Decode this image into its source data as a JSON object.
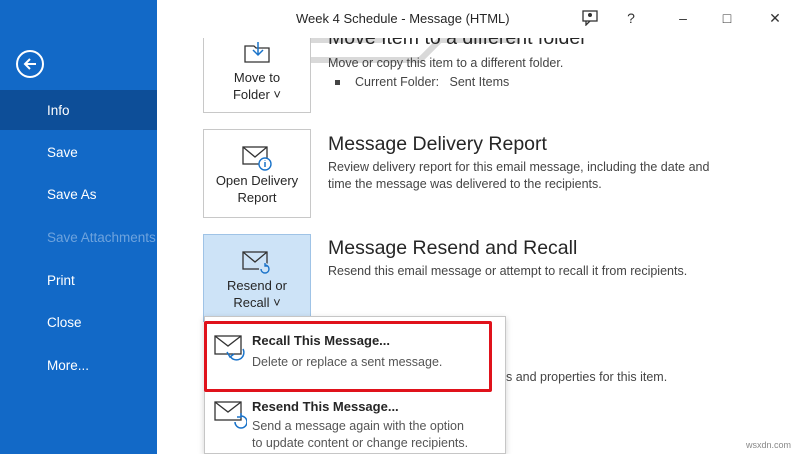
{
  "window": {
    "title": "Week 4 Schedule  -  Message (HTML)",
    "controls": {
      "help": "?",
      "minimize": "–",
      "maximize": "□",
      "close": "✕"
    }
  },
  "sidebar": {
    "items": [
      {
        "label": "Info"
      },
      {
        "label": "Save"
      },
      {
        "label": "Save As"
      },
      {
        "label": "Save Attachments"
      },
      {
        "label": "Print"
      },
      {
        "label": "Close"
      },
      {
        "label": "More..."
      }
    ]
  },
  "move_section": {
    "button_line1": "Move to",
    "button_line2": "Folder ˅",
    "title": "Move Item to a different folder",
    "desc": "Move or copy this item to a different folder.",
    "current_folder_label": "Current Folder:",
    "current_folder_value": "Sent Items"
  },
  "delivery_section": {
    "button_line1": "Open Delivery",
    "button_line2": "Report",
    "title": "Message Delivery Report",
    "desc": "Review delivery report for this email message, including the date and time the message was delivered to the recipients."
  },
  "resend_section": {
    "button_line1": "Resend or",
    "button_line2": "Recall ˅",
    "title": "Message Resend and Recall",
    "desc": "Resend this email message or attempt to recall it from recipients."
  },
  "dropdown": {
    "recall": {
      "title": "Recall This Message...",
      "desc": "Delete or replace a sent message."
    },
    "resend": {
      "title": "Resend This Message...",
      "desc_line1": "Send a message again with the option",
      "desc_line2": "to update content or change recipients."
    }
  },
  "partial_text": "s and properties for this item.",
  "watermark": "wsxdn.com",
  "colors": {
    "sidebar": "#1269c7",
    "sidebar_active": "#0d4e98",
    "highlight": "#e0121b",
    "pressed": "#cde3f7"
  }
}
